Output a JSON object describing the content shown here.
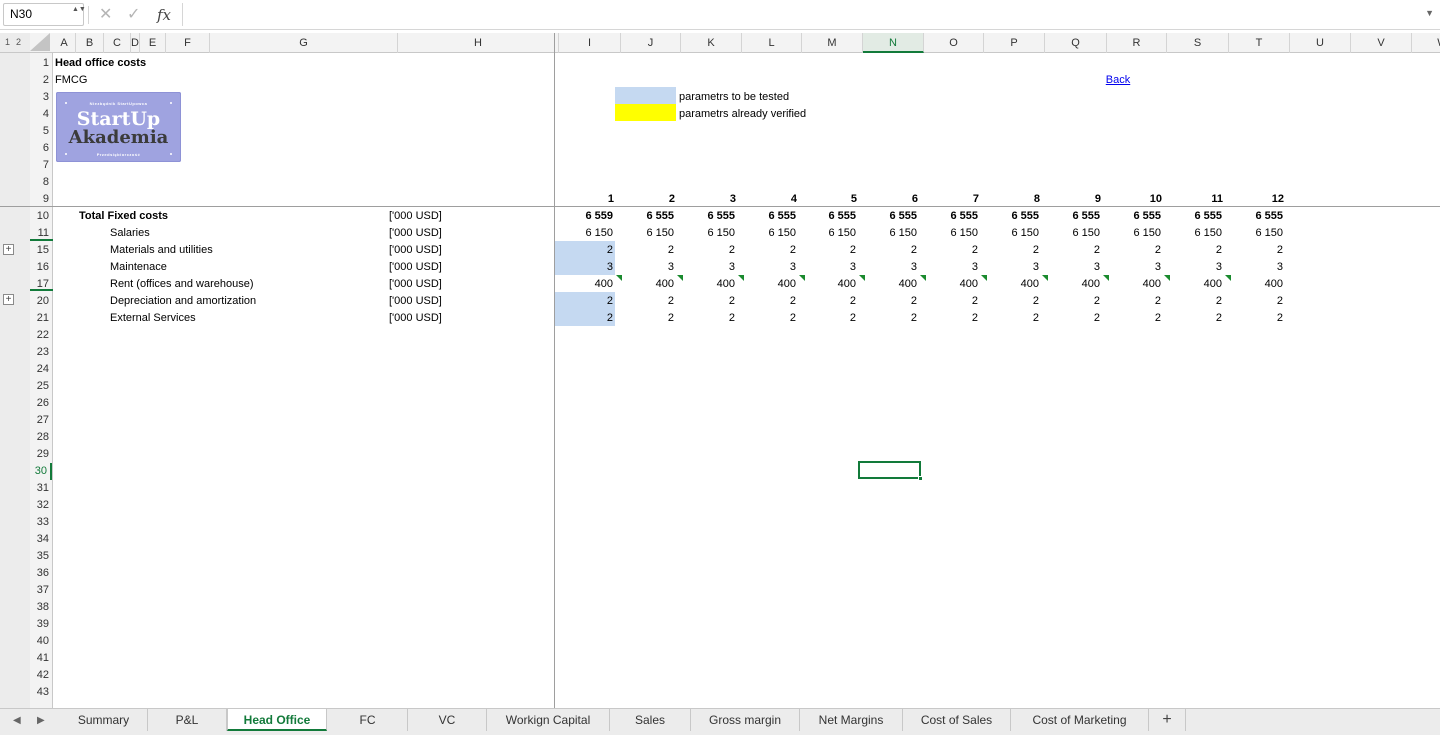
{
  "formula_bar": {
    "name_box": "N30",
    "name_box_stepper": "▲▼",
    "cancel_icon": "✕",
    "confirm_icon": "✓",
    "fx_label": "fx",
    "formula": "",
    "dropdown_icon": "▼"
  },
  "outline": {
    "levels": [
      "1",
      "2"
    ],
    "expand_symbol": "+"
  },
  "columns": [
    "A",
    "B",
    "C",
    "D",
    "E",
    "F",
    "G",
    "H",
    "I",
    "J",
    "K",
    "L",
    "M",
    "N",
    "O",
    "P",
    "Q",
    "R",
    "S",
    "T",
    "U",
    "V",
    "W"
  ],
  "rows": [
    "1",
    "2",
    "3",
    "4",
    "5",
    "6",
    "7",
    "8",
    "9",
    "10",
    "11",
    "15",
    "16",
    "17",
    "20",
    "21",
    "22",
    "23",
    "24",
    "25",
    "26",
    "27",
    "28",
    "29",
    "30",
    "31",
    "32",
    "33",
    "34",
    "35",
    "36",
    "37",
    "38",
    "39",
    "40",
    "41",
    "42",
    "43"
  ],
  "active_cell": {
    "column": "N",
    "row": "30"
  },
  "sheet": {
    "title": "Head office costs",
    "subtitle": "FMCG",
    "logo": {
      "top_text": "Niezbędnik StartUpowca",
      "word1": "StartUp",
      "word2": "Akademia",
      "bottom_text": "Przedsiębiorczość"
    },
    "legend": [
      {
        "label": "parametrs to be tested",
        "color": "#c5d9f1"
      },
      {
        "label": "parametrs already verified",
        "color": "#ffff00"
      }
    ],
    "back_link": "Back",
    "months": [
      "1",
      "2",
      "3",
      "4",
      "5",
      "6",
      "7",
      "8",
      "9",
      "10",
      "11",
      "12"
    ],
    "table": [
      {
        "label": "Total Fixed costs",
        "unit": "['000 USD]",
        "bold": true,
        "values": [
          "6 559",
          "6 555",
          "6 555",
          "6 555",
          "6 555",
          "6 555",
          "6 555",
          "6 555",
          "6 555",
          "6 555",
          "6 555",
          "6 555"
        ]
      },
      {
        "label": "Salaries",
        "unit": "['000 USD]",
        "bold": false,
        "values": [
          "6 150",
          "6 150",
          "6 150",
          "6 150",
          "6 150",
          "6 150",
          "6 150",
          "6 150",
          "6 150",
          "6 150",
          "6 150",
          "6 150"
        ]
      },
      {
        "label": "Materials and utilities",
        "unit": "['000 USD]",
        "bold": false,
        "values": [
          "2",
          "2",
          "2",
          "2",
          "2",
          "2",
          "2",
          "2",
          "2",
          "2",
          "2",
          "2"
        ]
      },
      {
        "label": "Maintenace",
        "unit": "['000 USD]",
        "bold": false,
        "values": [
          "3",
          "3",
          "3",
          "3",
          "3",
          "3",
          "3",
          "3",
          "3",
          "3",
          "3",
          "3"
        ]
      },
      {
        "label": "Rent (offices and warehouse)",
        "unit": "['000 USD]",
        "bold": false,
        "values": [
          "400",
          "400",
          "400",
          "400",
          "400",
          "400",
          "400",
          "400",
          "400",
          "400",
          "400",
          "400"
        ]
      },
      {
        "label": "Depreciation and amortization",
        "unit": "['000 USD]",
        "bold": false,
        "values": [
          "2",
          "2",
          "2",
          "2",
          "2",
          "2",
          "2",
          "2",
          "2",
          "2",
          "2",
          "2"
        ]
      },
      {
        "label": "External Services",
        "unit": "['000 USD]",
        "bold": false,
        "values": [
          "2",
          "2",
          "2",
          "2",
          "2",
          "2",
          "2",
          "2",
          "2",
          "2",
          "2",
          "2"
        ]
      }
    ]
  },
  "tabs": {
    "nav_prev": "◀",
    "nav_next": "▶",
    "items": [
      "Summary",
      "P&L",
      "Head Office",
      "FC",
      "VC",
      "Workign Capital",
      "Sales",
      "Gross margin",
      "Net Margins",
      "Cost of Sales",
      "Cost of Marketing"
    ],
    "active": "Head Office",
    "add_label": "+"
  }
}
